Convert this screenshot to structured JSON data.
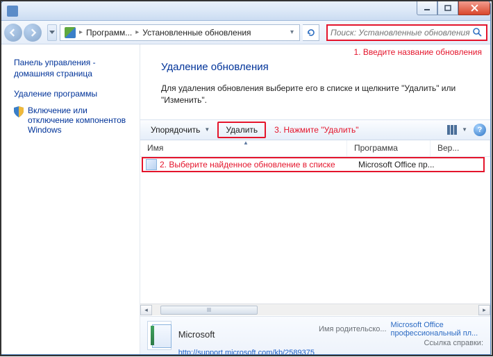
{
  "window": {
    "title": ""
  },
  "nav": {
    "crumb1": "Программ...",
    "crumb2": "Установленные обновления"
  },
  "search": {
    "placeholder": "Поиск: Установленные обновления"
  },
  "annotations": {
    "a1": "1. Введите название обновления",
    "a2": "2. Выберите найденное обновление в списке",
    "a3": "3. Нажмите \"Удалить\""
  },
  "sidebar": {
    "cp_home": "Панель управления - домашняя страница",
    "uninstall_program": "Удаление программы",
    "windows_features": "Включение или отключение компонентов Windows"
  },
  "page": {
    "title": "Удаление обновления",
    "desc": "Для удаления обновления выберите его в списке и щелкните \"Удалить\" или \"Изменить\"."
  },
  "cmd": {
    "organize": "Упорядочить",
    "delete": "Удалить"
  },
  "columns": {
    "name": "Имя",
    "program": "Программа",
    "version": "Вер..."
  },
  "row": {
    "program": "Microsoft Office пр..."
  },
  "details": {
    "vendor": "Microsoft",
    "parent_label": "Имя родительско...",
    "parent_value": "Microsoft Office профессиональный пл...",
    "help_label": "Ссылка справки:",
    "help_value": "http://support.microsoft.com/kb/2589375"
  }
}
